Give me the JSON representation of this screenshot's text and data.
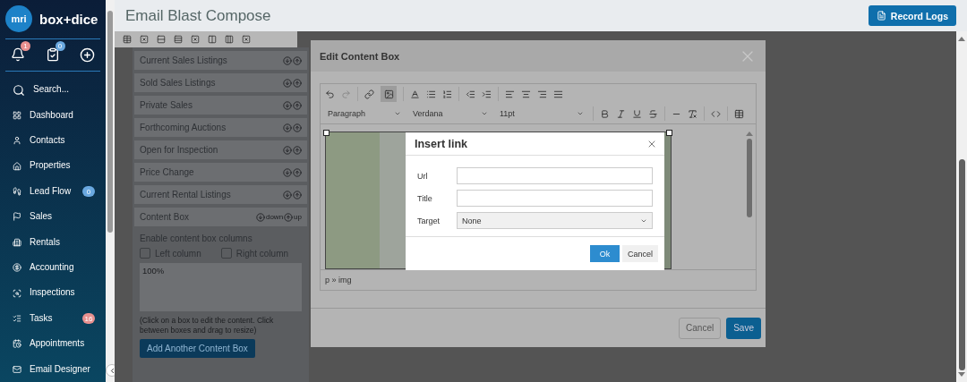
{
  "sidebar": {
    "logo_mark": "mri",
    "brand": "box+dice",
    "alerts_count": "1",
    "tasks_count": "0",
    "items": [
      {
        "kind": "search",
        "label": "Search..."
      },
      {
        "kind": "dashboard",
        "label": "Dashboard"
      },
      {
        "kind": "contacts",
        "label": "Contacts"
      },
      {
        "kind": "properties",
        "label": "Properties"
      },
      {
        "kind": "leadflow",
        "label": "Lead Flow",
        "badge": {
          "text": "0",
          "color": "#6aa8e0"
        }
      },
      {
        "kind": "sales",
        "label": "Sales"
      },
      {
        "kind": "rentals",
        "label": "Rentals"
      },
      {
        "kind": "accounting",
        "label": "Accounting"
      },
      {
        "kind": "inspections",
        "label": "Inspections"
      },
      {
        "kind": "tasks",
        "label": "Tasks",
        "badge": {
          "text": "16",
          "color": "#e8908f"
        }
      },
      {
        "kind": "appointments",
        "label": "Appointments"
      },
      {
        "kind": "email",
        "label": "Email Designer"
      }
    ]
  },
  "header": {
    "title": "Email Blast Compose",
    "button": "Record Logs"
  },
  "sections": {
    "items": [
      {
        "title": "Current Sales Listings"
      },
      {
        "title": "Sold Sales Listings"
      },
      {
        "title": "Private Sales"
      },
      {
        "title": "Forthcoming Auctions"
      },
      {
        "title": "Open for Inspection"
      },
      {
        "title": "Price Change"
      },
      {
        "title": "Current Rental Listings"
      },
      {
        "title": "Content Box",
        "down": "down",
        "up": "up"
      }
    ],
    "columns_label": "Enable content box columns",
    "checkboxes": [
      {
        "label": "Left column",
        "checked": false
      },
      {
        "label": "Right column",
        "checked": false
      }
    ],
    "content_box": "100%",
    "hint": "(Click on a box to edit the content. Click between boxes and drag to resize)",
    "add_button": "Add Another Content Box"
  },
  "modal": {
    "title": "Edit Content Box",
    "image_tool_active": true,
    "dropdowns": [
      {
        "value": "Paragraph"
      },
      {
        "value": "Verdana"
      },
      {
        "value": "11pt"
      }
    ],
    "path": "p » img",
    "cancel": "Cancel",
    "save": "Save"
  },
  "dialog": {
    "title": "Insert link",
    "fields": [
      {
        "kind": "text",
        "label": "Url"
      },
      {
        "kind": "text",
        "label": "Title"
      },
      {
        "kind": "select",
        "label": "Target",
        "value": "None"
      }
    ],
    "ok": "Ok",
    "cancel": "Cancel"
  }
}
